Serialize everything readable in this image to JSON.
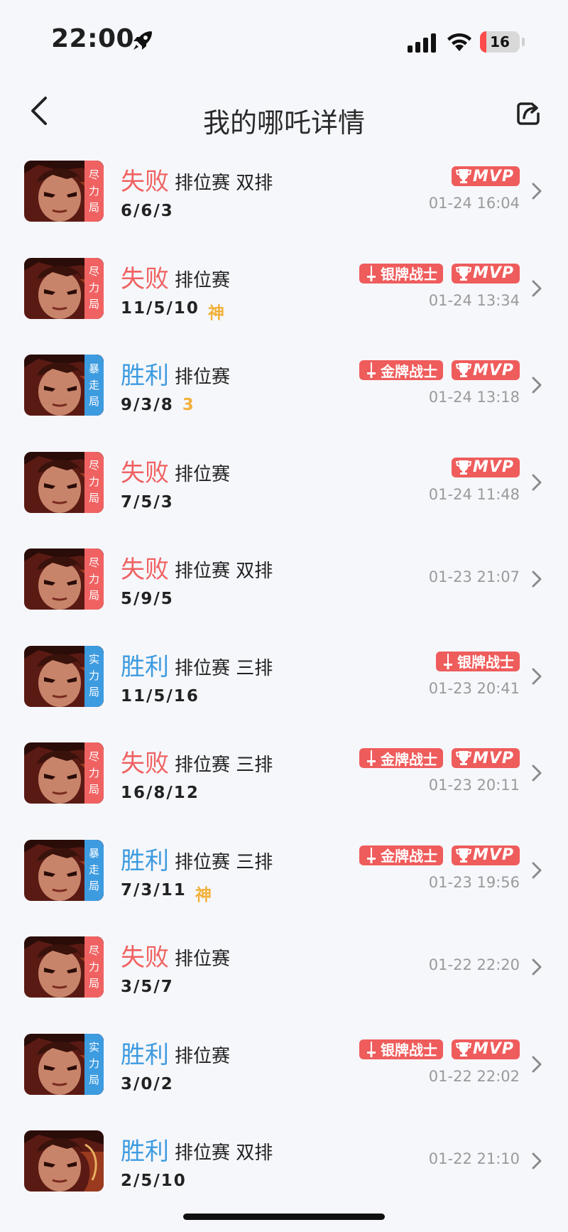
{
  "status_bar": {
    "time": "22:00",
    "battery": "16",
    "battery_level_percent": 16
  },
  "nav": {
    "title": "我的哪吒详情"
  },
  "colors": {
    "loss": "#f06262",
    "win": "#3d9be0",
    "badge": "#ef5c5c",
    "extra": "#f2b13b"
  },
  "matches": [
    {
      "result": "失败",
      "outcome": "loss",
      "mode": "排位赛 双排",
      "kda": "6/6/3",
      "extra": "",
      "tag": [
        "尽",
        "力",
        "局"
      ],
      "badges": [
        "MVP"
      ],
      "datetime": "01-24 16:04"
    },
    {
      "result": "失败",
      "outcome": "loss",
      "mode": "排位赛",
      "kda": "11/5/10",
      "extra": "神",
      "tag": [
        "尽",
        "力",
        "局"
      ],
      "badges": [
        "银牌战士",
        "MVP"
      ],
      "datetime": "01-24 13:34"
    },
    {
      "result": "胜利",
      "outcome": "win",
      "mode": "排位赛",
      "kda": "9/3/8",
      "extra": "3",
      "tag": [
        "暴",
        "走",
        "局"
      ],
      "badges": [
        "金牌战士",
        "MVP"
      ],
      "datetime": "01-24 13:18"
    },
    {
      "result": "失败",
      "outcome": "loss",
      "mode": "排位赛",
      "kda": "7/5/3",
      "extra": "",
      "tag": [
        "尽",
        "力",
        "局"
      ],
      "badges": [
        "MVP"
      ],
      "datetime": "01-24 11:48"
    },
    {
      "result": "失败",
      "outcome": "loss",
      "mode": "排位赛 双排",
      "kda": "5/9/5",
      "extra": "",
      "tag": [
        "尽",
        "力",
        "局"
      ],
      "badges": [],
      "datetime": "01-23 21:07"
    },
    {
      "result": "胜利",
      "outcome": "win",
      "mode": "排位赛 三排",
      "kda": "11/5/16",
      "extra": "",
      "tag": [
        "实",
        "力",
        "局"
      ],
      "badges": [
        "银牌战士"
      ],
      "datetime": "01-23 20:41"
    },
    {
      "result": "失败",
      "outcome": "loss",
      "mode": "排位赛 三排",
      "kda": "16/8/12",
      "extra": "",
      "tag": [
        "尽",
        "力",
        "局"
      ],
      "badges": [
        "金牌战士",
        "MVP"
      ],
      "datetime": "01-23 20:11"
    },
    {
      "result": "胜利",
      "outcome": "win",
      "mode": "排位赛 三排",
      "kda": "7/3/11",
      "extra": "神",
      "tag": [
        "暴",
        "走",
        "局"
      ],
      "badges": [
        "金牌战士",
        "MVP"
      ],
      "datetime": "01-23 19:56"
    },
    {
      "result": "失败",
      "outcome": "loss",
      "mode": "排位赛",
      "kda": "3/5/7",
      "extra": "",
      "tag": [
        "尽",
        "力",
        "局"
      ],
      "badges": [],
      "datetime": "01-22 22:20"
    },
    {
      "result": "胜利",
      "outcome": "win",
      "mode": "排位赛",
      "kda": "3/0/2",
      "extra": "",
      "tag": [
        "实",
        "力",
        "局"
      ],
      "badges": [
        "银牌战士",
        "MVP"
      ],
      "datetime": "01-22 22:02"
    },
    {
      "result": "胜利",
      "outcome": "win",
      "mode": "排位赛 双排",
      "kda": "2/5/10",
      "extra": "",
      "tag": [],
      "badges": [],
      "datetime": "01-22 21:10"
    }
  ]
}
